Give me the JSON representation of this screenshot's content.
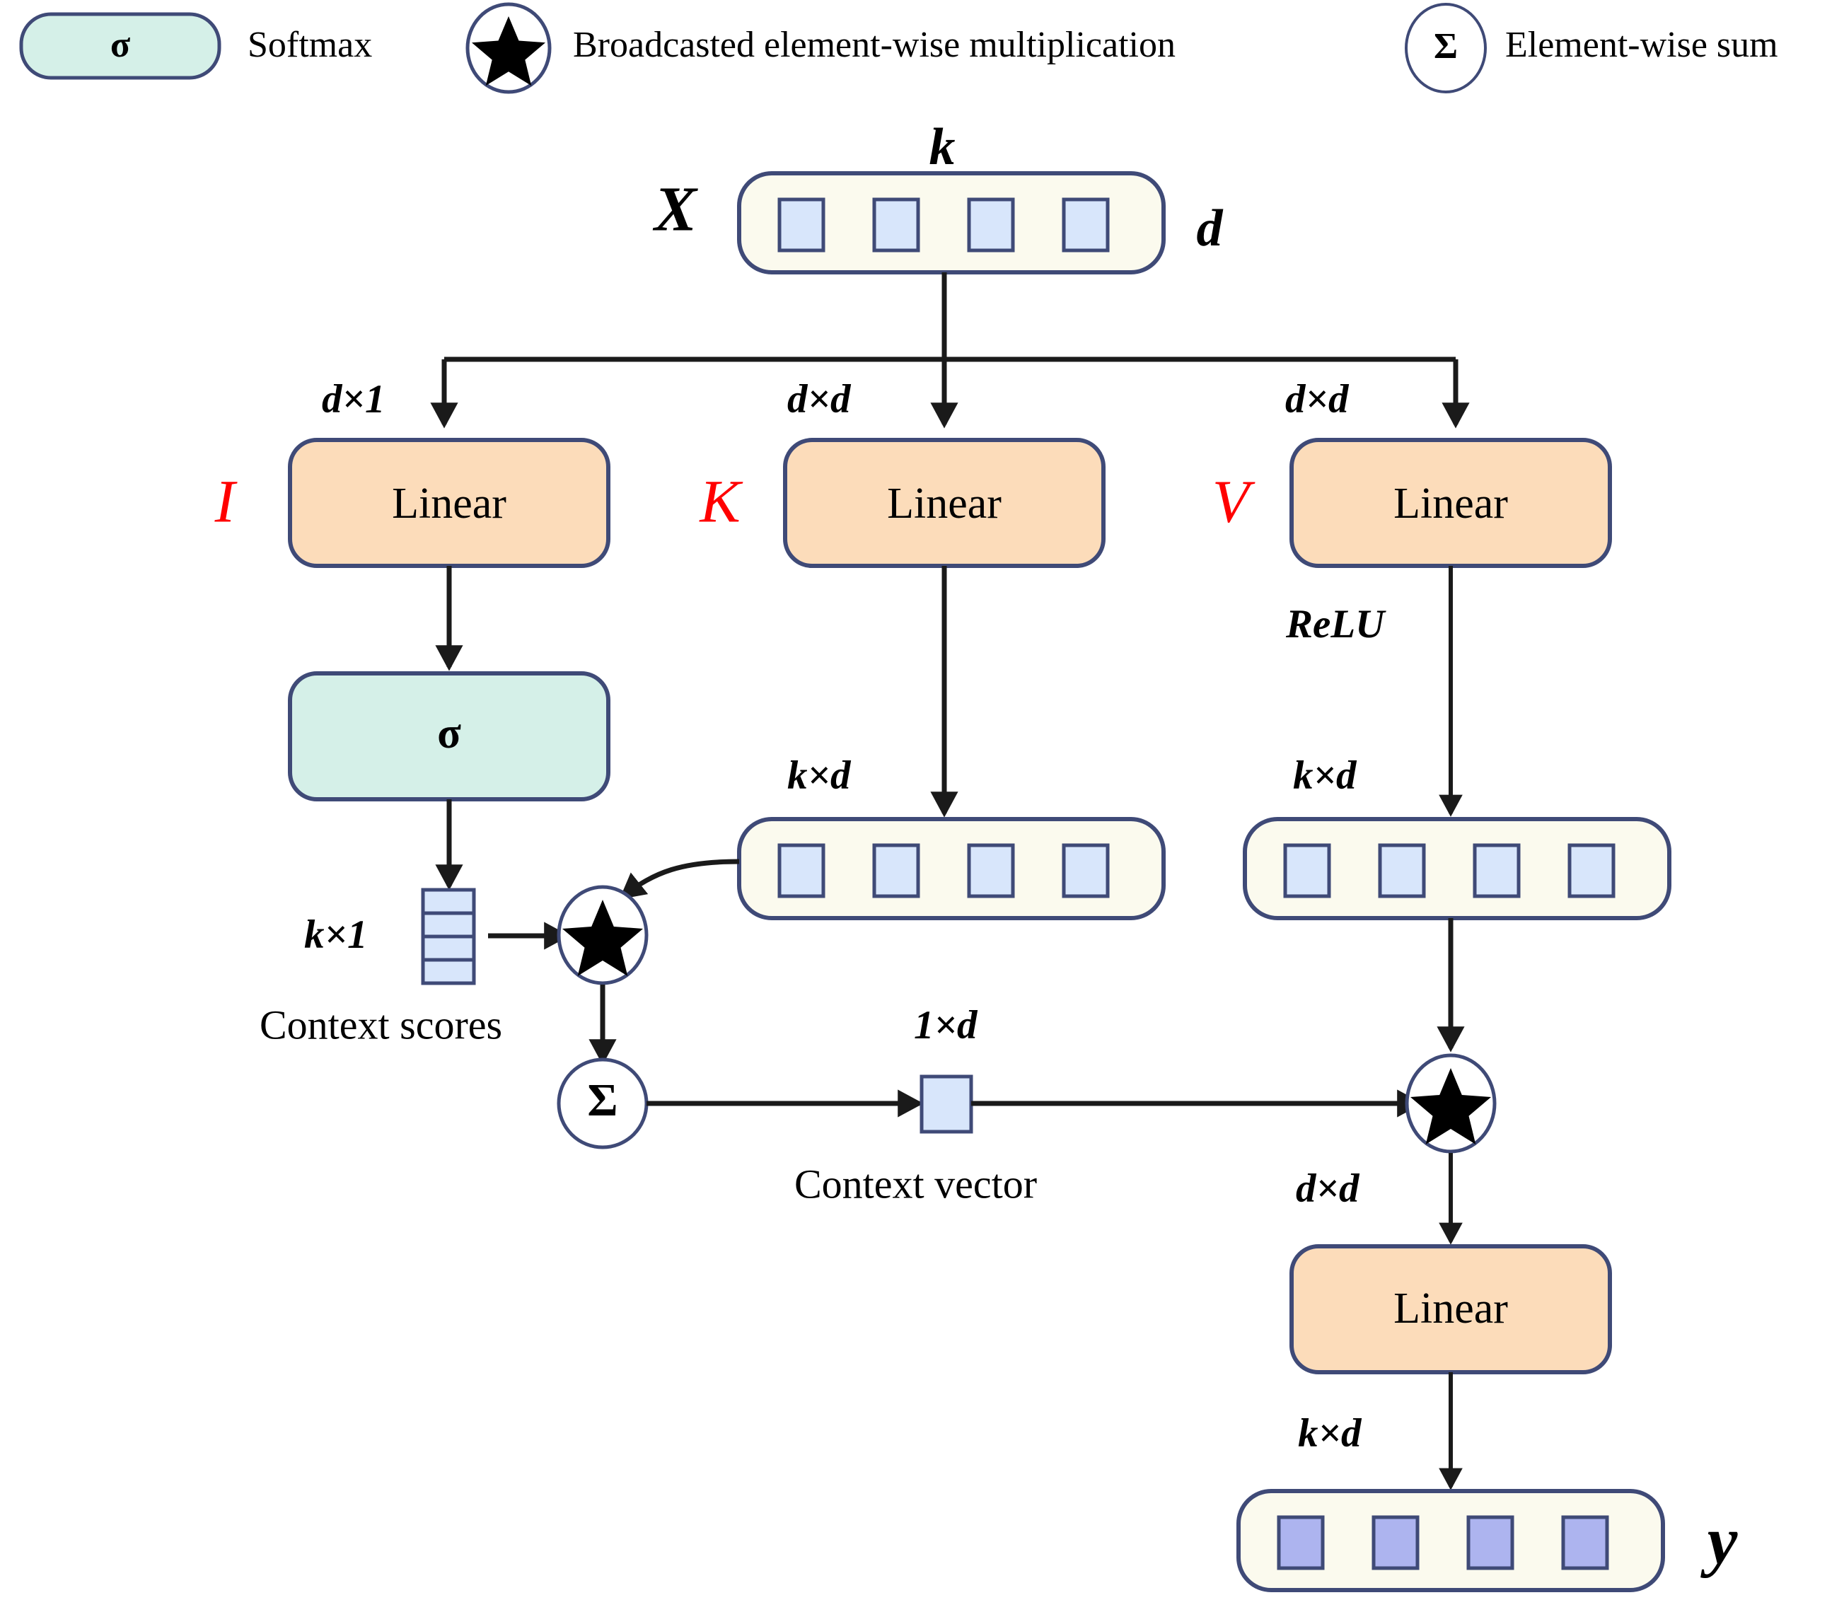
{
  "legend": {
    "items": [
      {
        "icon": "softmax-box-icon",
        "glyph": "σ",
        "label": "Softmax"
      },
      {
        "icon": "star-circle-icon",
        "glyph": "★",
        "label": "Broadcasted element-wise multiplication"
      },
      {
        "icon": "sum-circle-icon",
        "glyph": "Σ",
        "label": "Element-wise sum"
      }
    ]
  },
  "diagram": {
    "input": {
      "var_label": "X",
      "top_dim": "k",
      "side_dim": "d",
      "cell_count": 4
    },
    "branches": [
      {
        "name": "I",
        "dim": "d×1",
        "box_label": "Linear"
      },
      {
        "name": "K",
        "dim": "d×d",
        "box_label": "Linear"
      },
      {
        "name": "V",
        "dim": "d×d",
        "box_label": "Linear"
      }
    ],
    "softmax_box": {
      "glyph": "σ"
    },
    "context_scores": {
      "dim": "k×1",
      "caption": "Context scores",
      "cell_count": 4
    },
    "k_output": {
      "dim": "k×d",
      "cell_count": 4
    },
    "v_activation": "ReLU",
    "v_output": {
      "dim": "k×d",
      "cell_count": 4
    },
    "multiply_1": {
      "glyph": "★"
    },
    "sum_node": {
      "glyph": "Σ"
    },
    "context_vector": {
      "dim": "1×d",
      "caption": "Context vector"
    },
    "multiply_2": {
      "glyph": "★"
    },
    "final_linear": {
      "dim": "d×d",
      "box_label": "Linear"
    },
    "output": {
      "var_label": "y",
      "dim": "k×d",
      "cell_count": 4
    }
  },
  "colors": {
    "linear_fill": "#fcdcba",
    "softmax_fill": "#d5f0e8",
    "container_fill": "#fbfaee",
    "cell_fill": "#d8e6fb",
    "output_cell_fill": "#adb4ef",
    "border": "#3f4a77",
    "arrow": "#1a1a1a",
    "branch_text": "#ff0000"
  }
}
